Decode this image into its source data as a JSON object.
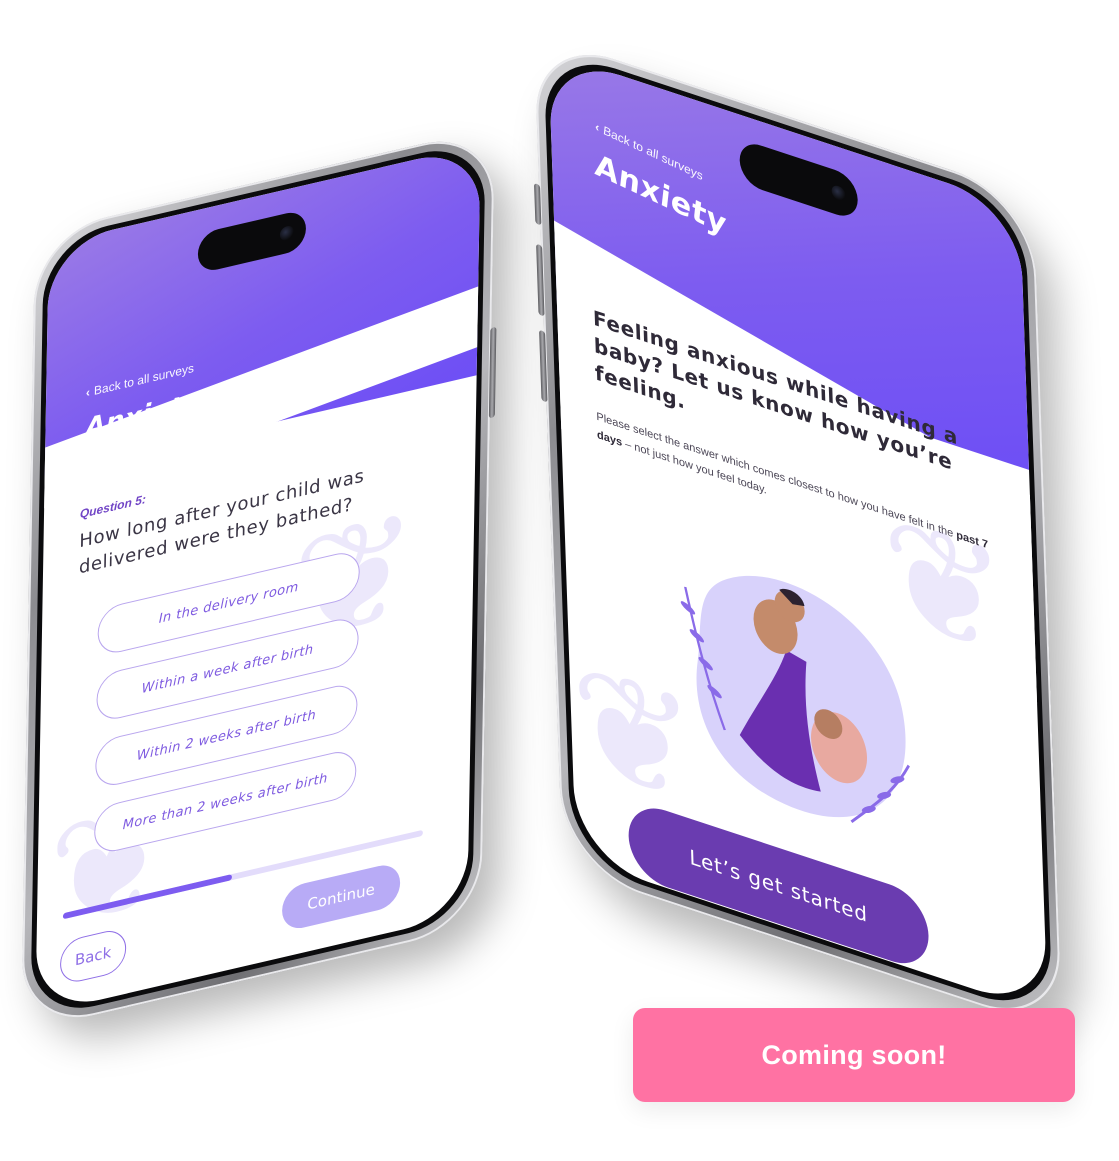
{
  "survey": {
    "back_link": "Back to all surveys",
    "title": "Anxiety"
  },
  "question_screen": {
    "question_label": "Question 5:",
    "question_text": "How long after your child was delivered were they bathed?",
    "options": [
      "In the delivery room",
      "Within a week after birth",
      "Within 2 weeks after birth",
      "More than 2 weeks after birth"
    ],
    "progress_fraction": 0.47,
    "back_label": "Back",
    "continue_label": "Continue"
  },
  "intro_screen": {
    "heading": "Feeling anxious while having a baby? Let us know how you’re feeling.",
    "body_prefix": "Please select the answer which comes closest to how you have felt in the ",
    "body_bold": "past 7 days",
    "body_suffix": " – not just how you feel today.",
    "start_label": "Let’s get started"
  },
  "badge": {
    "label": "Coming soon!"
  },
  "colors": {
    "header_gradient_start": "#9a7ae6",
    "header_gradient_end": "#6e4ff5",
    "option_border": "#b9a6ee",
    "start_button": "#6a3cb0",
    "continue_button": "#b8abf6",
    "badge": "#ff72a3"
  },
  "icons": [
    "chevron-left-icon",
    "leaf-decoration-icon",
    "mother-baby-illustration"
  ]
}
